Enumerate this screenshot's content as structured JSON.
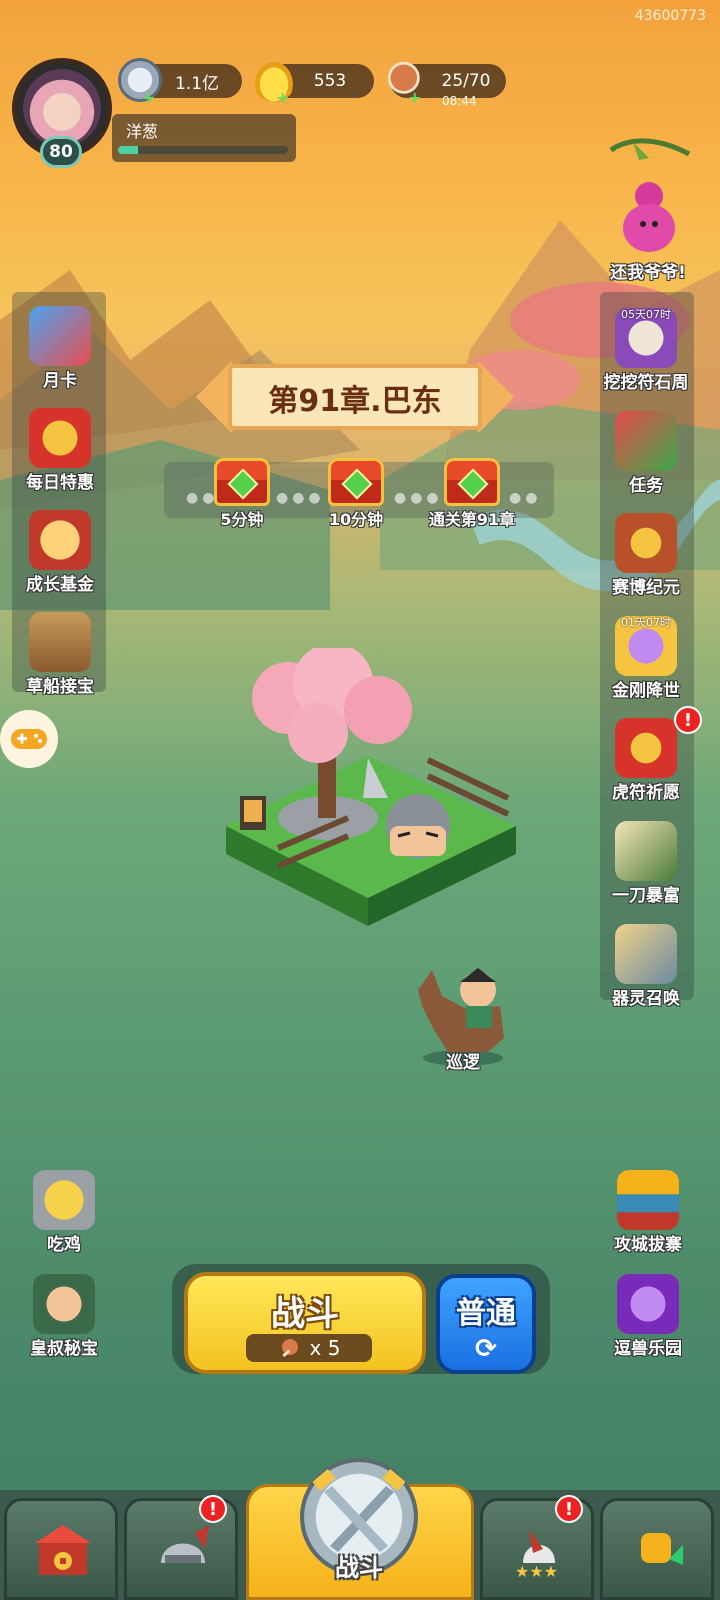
{
  "account_id": "43600773",
  "player": {
    "name": "洋葱",
    "level": "80",
    "xp_fraction": 0.12
  },
  "resources": {
    "silver": "1.1亿",
    "gold": "553",
    "stamina": "25/70",
    "stamina_timer": "08:44"
  },
  "top_right_event": {
    "label": "还我爷爷!"
  },
  "left_menu": [
    {
      "label": "月卡",
      "icon": "month-card-icon"
    },
    {
      "label": "每日特惠",
      "icon": "gift-bag-icon"
    },
    {
      "label": "成长基金",
      "icon": "growth-fund-icon"
    },
    {
      "label": "草船接宝",
      "icon": "straw-boat-icon"
    }
  ],
  "right_menu": [
    {
      "label": "挖挖符石周",
      "timer": "05天07时",
      "icon": "rune-dig-icon"
    },
    {
      "label": "任务",
      "timer": "",
      "icon": "task-scroll-icon"
    },
    {
      "label": "赛博纪元",
      "timer": "",
      "icon": "cyber-era-icon"
    },
    {
      "label": "金刚降世",
      "timer": "01天07时",
      "icon": "vajra-icon"
    },
    {
      "label": "虎符祈愿",
      "timer": "",
      "icon": "tiger-tally-icon",
      "alert": "!"
    },
    {
      "label": "一刀暴富",
      "timer": "",
      "icon": "fortune-blade-icon"
    },
    {
      "label": "器灵召唤",
      "timer": "",
      "icon": "spirit-summon-icon"
    }
  ],
  "chapter": {
    "title": "第91章.巴东"
  },
  "chests": [
    {
      "label": "5分钟"
    },
    {
      "label": "10分钟"
    },
    {
      "label": "通关第91章"
    }
  ],
  "patrol": {
    "label": "巡逻"
  },
  "left_bottom": [
    {
      "label": "吃鸡",
      "icon": "chicken-icon"
    },
    {
      "label": "皇叔秘宝",
      "icon": "uncle-treasure-icon"
    }
  ],
  "right_bottom": [
    {
      "label": "攻城拔寨",
      "icon": "siege-icon"
    },
    {
      "label": "逗兽乐园",
      "icon": "beast-park-icon"
    }
  ],
  "battle": {
    "button_label": "战斗",
    "cost": "x 5",
    "mode_label": "普通",
    "refresh_glyph": "⟳"
  },
  "bottom_nav": {
    "center_label": "战斗",
    "alert": "!"
  },
  "colors": {
    "sky_top": "#f3a23d",
    "grass": "#4d8b6b",
    "fight_button": "#f3c21f",
    "mode_button": "#1a6fe0",
    "alert": "#e22222"
  }
}
